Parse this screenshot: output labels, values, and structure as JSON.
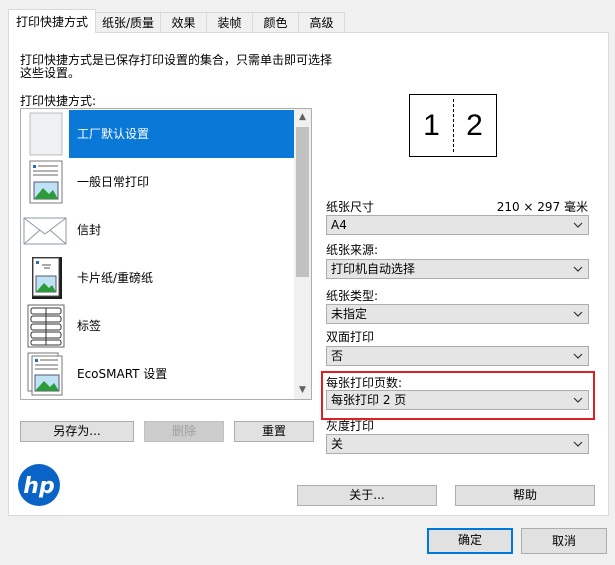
{
  "tabs": [
    {
      "label": "打印快捷方式",
      "active": true
    },
    {
      "label": "纸张/质量"
    },
    {
      "label": "效果"
    },
    {
      "label": "装帧"
    },
    {
      "label": "颜色"
    },
    {
      "label": "高级"
    }
  ],
  "intro": {
    "line1": "打印快捷方式是已保存打印设置的集合，只需单击即可选择",
    "line2": "这些设置。"
  },
  "shortcuts": {
    "heading": "打印快捷方式:",
    "items": [
      {
        "label": "工厂默认设置",
        "icon": "blank-page-icon",
        "selected": true
      },
      {
        "label": "一般日常打印",
        "icon": "document-page-icon"
      },
      {
        "label": "信封",
        "icon": "envelope-icon"
      },
      {
        "label": "卡片纸/重磅纸",
        "icon": "card-stock-icon"
      },
      {
        "label": "标签",
        "icon": "labels-sheet-icon"
      },
      {
        "label": "EcoSMART 设置",
        "icon": "eco-document-icon"
      }
    ]
  },
  "buttons": {
    "save_as": "另存为...",
    "delete": "删除",
    "reset": "重置",
    "about": "关于...",
    "help": "帮助",
    "ok": "确定",
    "cancel": "取消"
  },
  "preview": {
    "page1": "1",
    "page2": "2"
  },
  "settings": {
    "paper_size": {
      "label": "纸张尺寸",
      "dimension": "210 × 297 毫米",
      "value": "A4"
    },
    "paper_source": {
      "label": "纸张来源:",
      "value": "打印机自动选择"
    },
    "paper_type": {
      "label": "纸张类型:",
      "value": "未指定"
    },
    "duplex": {
      "label": "双面打印",
      "value": "否"
    },
    "pages_per_sheet": {
      "label": "每张打印页数:",
      "value": "每张打印 2 页"
    },
    "grayscale": {
      "label": "灰度打印",
      "value": "关"
    }
  },
  "colors": {
    "accent": "#0a78d7",
    "highlight_box": "#e02020",
    "hp_logo": "#0a64c8"
  }
}
